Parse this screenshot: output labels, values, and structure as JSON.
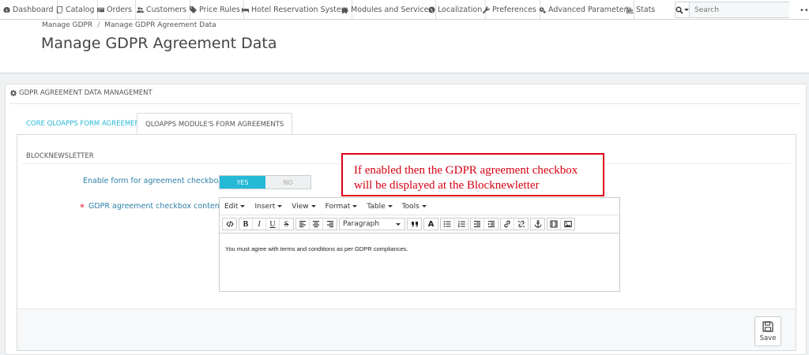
{
  "nav": {
    "items": [
      {
        "label": "Dashboard",
        "icon": "dashboard-icon"
      },
      {
        "label": "Catalog",
        "icon": "book-icon"
      },
      {
        "label": "Orders",
        "icon": "credit-card-icon"
      },
      {
        "label": "Customers",
        "icon": "users-icon"
      },
      {
        "label": "Price Rules",
        "icon": "tags-icon"
      },
      {
        "label": "Hotel Reservation System",
        "icon": "bed-icon"
      },
      {
        "label": "Modules and Services",
        "icon": "puzzle-icon"
      },
      {
        "label": "Localization",
        "icon": "globe-icon"
      },
      {
        "label": "Preferences",
        "icon": "wrench-icon"
      },
      {
        "label": "Advanced Parameters",
        "icon": "cogs-icon"
      },
      {
        "label": "Stats",
        "icon": "bar-chart-icon"
      }
    ],
    "search_placeholder": "Search",
    "more": "•••"
  },
  "breadcrumb": {
    "items": [
      "Manage GDPR",
      "Manage GDPR Agreement Data"
    ],
    "separator": "/"
  },
  "page_title": "Manage GDPR Agreement Data",
  "panel": {
    "heading": "GDPR AGREEMENT DATA MANAGEMENT"
  },
  "tabs": [
    {
      "label": "CORE QLOAPPS FORM AGREEMENTS",
      "active": false
    },
    {
      "label": "QLOAPPS MODULE'S FORM AGREEMENTS",
      "active": true
    }
  ],
  "section": {
    "title": "BLOCKNEWSLETTER"
  },
  "form": {
    "enable_label": "Enable form for agreement checkbox",
    "switch_yes": "YES",
    "switch_no": "NO",
    "switch_value": "YES",
    "required_mark": "*",
    "content_label": "GDPR agreement checkbox content"
  },
  "editor": {
    "menus": [
      "Edit",
      "Insert",
      "View",
      "Format",
      "Table",
      "Tools"
    ],
    "format_select": "Paragraph",
    "content": "You must agree with terms and conditions as per GDPR compliances."
  },
  "callout": {
    "line1": "If enabled then the GDPR agreement checkbox",
    "line2": "will be displayed at the Blocknewletter"
  },
  "footer": {
    "save_label": "Save"
  },
  "colors": {
    "accent": "#25b9d7",
    "label": "#2e7fa8",
    "callout": "#e0001a"
  }
}
